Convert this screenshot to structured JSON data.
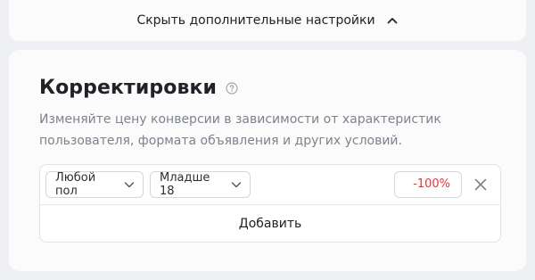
{
  "toggle": {
    "label": "Скрыть дополнительные настройки",
    "icon": "chevron-up-icon"
  },
  "section": {
    "title": "Корректировки",
    "help_icon": "question-circle-icon",
    "description_line1": "Изменяйте цену конверсии в зависимости от характеристик",
    "description_line2": "пользователя, формата объявления и других условий."
  },
  "rule": {
    "gender": {
      "value": "Любой пол",
      "icon": "chevron-down-icon"
    },
    "age": {
      "value": "Младше 18",
      "icon": "chevron-down-icon"
    },
    "adjustment": "-100%",
    "remove_icon": "close-icon"
  },
  "add_label": "Добавить",
  "colors": {
    "background": "#eef0f3",
    "card": "#fbfbfc",
    "negative": "#e63535",
    "muted_text": "#7d838c"
  }
}
